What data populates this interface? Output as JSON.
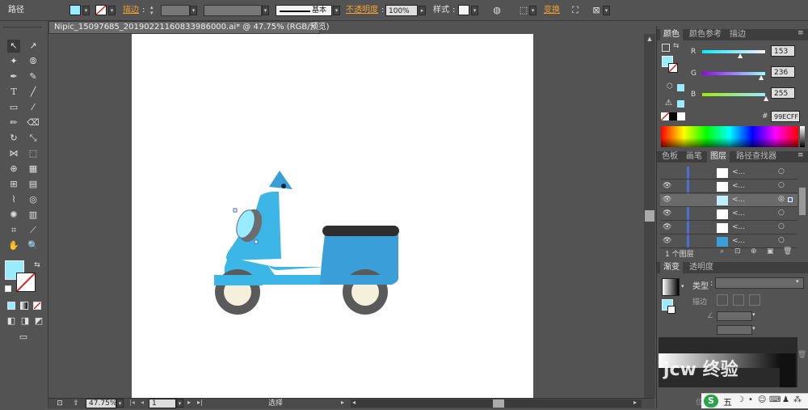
{
  "control_bar": {
    "object_type": "路径",
    "stroke_label": "描边",
    "stroke_profile": "基本",
    "opacity_label": "不透明度",
    "opacity_value": "100%",
    "style_label": "样式",
    "transform_label": "变换"
  },
  "document_tab": {
    "title": "Nipic_15097685_20190221160833986000.ai* @ 47.75% (RGB/预览)",
    "close": "×"
  },
  "status_bar": {
    "zoom": "47.75%",
    "artboard_number": "1",
    "current_tool": "选择"
  },
  "color_panel": {
    "tabs": [
      "颜色",
      "颜色参考",
      "描边"
    ],
    "r_label": "R",
    "r_value": "153",
    "g_label": "G",
    "g_value": "236",
    "b_label": "B",
    "b_value": "255",
    "hex_prefix": "#",
    "hex_value": "99ECFF"
  },
  "layers_panel": {
    "tabs": [
      "色板",
      "画笔",
      "图层",
      "路径查找器"
    ],
    "rows": [
      {
        "name": "<..."
      },
      {
        "name": "<..."
      },
      {
        "name": "<..."
      },
      {
        "name": "<..."
      },
      {
        "name": "<..."
      },
      {
        "name": "<..."
      }
    ],
    "footer": "1 个图层"
  },
  "gradient_panel": {
    "tabs": [
      "渐变",
      "透明度"
    ],
    "type_label": "类型",
    "stroke_label": "描边",
    "position_label": "位置"
  },
  "colors": {
    "fill": "#99ECFF",
    "scooter_body": "#3BB6E6",
    "scooter_rear": "#3A9FD8",
    "seat": "#2E2E2E",
    "wheel": "#5A5A5A",
    "hub": "#F5F0DC"
  },
  "taskbar": {
    "ime_mode": "五"
  },
  "watermark": {
    "text": "jcw 终验"
  }
}
